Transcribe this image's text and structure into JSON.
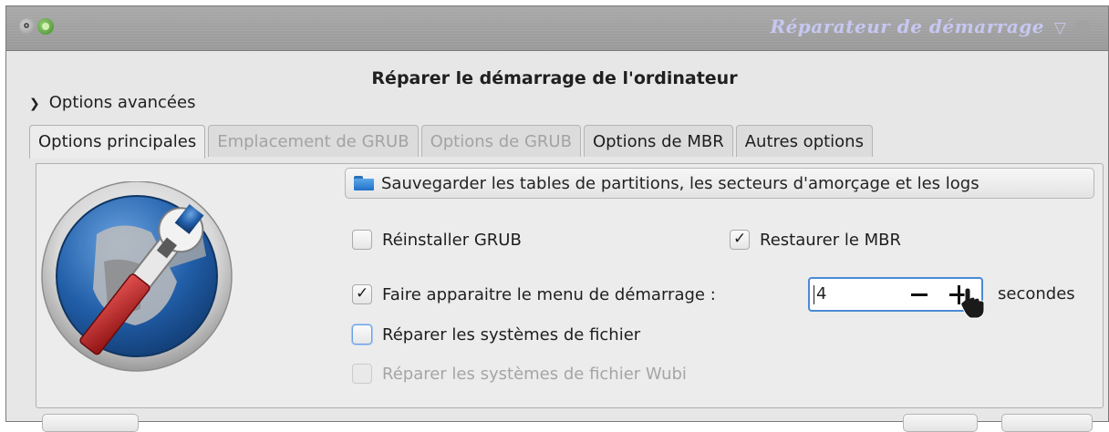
{
  "window": {
    "title": "Réparateur de démarrage",
    "buttons": [
      "menu-icon",
      "sticky-icon",
      "shade-icon",
      "close-icon"
    ]
  },
  "heading": "Réparer le démarrage de l'ordinateur",
  "expander": {
    "label": "Options avancées",
    "expanded": true
  },
  "tabs": [
    {
      "label": "Options principales",
      "state": "active"
    },
    {
      "label": "Emplacement de GRUB",
      "state": "disabled"
    },
    {
      "label": "Options de GRUB",
      "state": "disabled"
    },
    {
      "label": "Options de MBR",
      "state": "normal"
    },
    {
      "label": "Autres options",
      "state": "normal"
    }
  ],
  "main": {
    "logo_icon": "boot-repair-logo-icon",
    "save_button": {
      "label": "Sauvegarder les tables de partitions, les secteurs d'amorçage et les logs",
      "icon": "folder-icon"
    },
    "checkboxes": {
      "reinstall_grub": {
        "label": "Réinstaller GRUB",
        "checked": false
      },
      "restore_mbr": {
        "label": "Restaurer le MBR",
        "checked": true
      },
      "show_menu": {
        "label": "Faire apparaitre le menu de démarrage :",
        "checked": true
      },
      "repair_fs": {
        "label": "Réparer les systèmes de fichier",
        "checked": false
      },
      "repair_wubi": {
        "label": "Réparer les systèmes de fichier Wubi",
        "checked": false,
        "disabled": true
      }
    },
    "menu_timeout": {
      "value": "4",
      "unit": "secondes"
    }
  },
  "colors": {
    "accent": "#4a8ad6",
    "title_text": "#c7c7f2",
    "titlebar": "#a3a3a3",
    "window_bg": "#e7e7e7"
  }
}
